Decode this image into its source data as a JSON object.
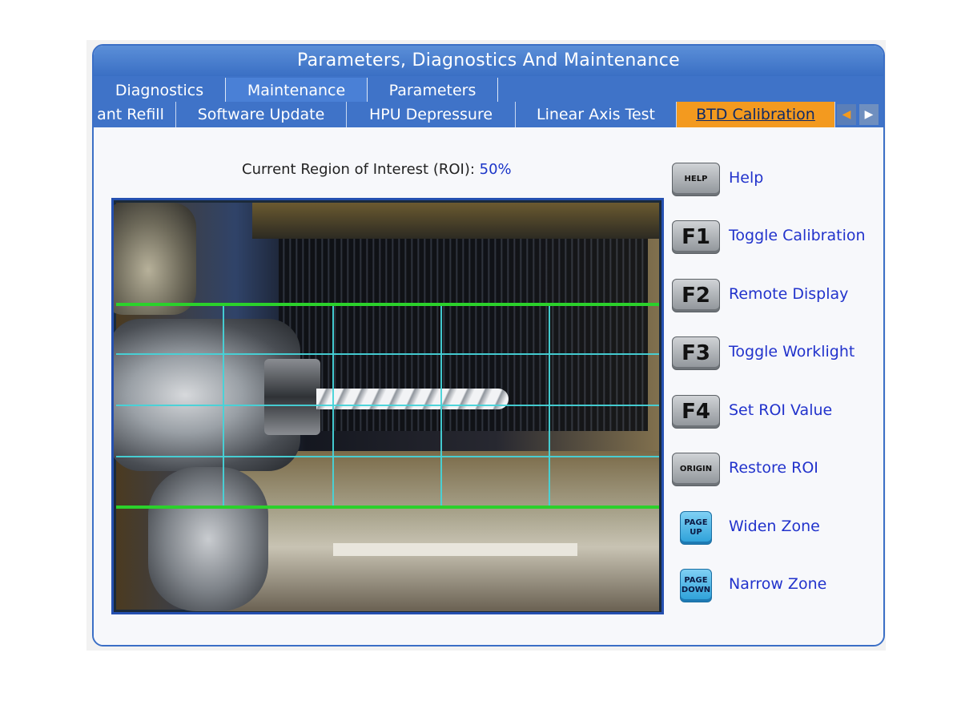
{
  "window": {
    "title": "Parameters, Diagnostics And Maintenance"
  },
  "tabs_primary": [
    {
      "label": "Diagnostics",
      "active": false
    },
    {
      "label": "Maintenance",
      "active": true
    },
    {
      "label": "Parameters",
      "active": false
    }
  ],
  "tabs_secondary": [
    {
      "label": "ant Refill",
      "active": false
    },
    {
      "label": "Software Update",
      "active": false
    },
    {
      "label": "HPU Depressure",
      "active": false
    },
    {
      "label": "Linear Axis Test",
      "active": false
    },
    {
      "label": "BTD Calibration",
      "active": true
    }
  ],
  "scroll_arrows": {
    "left": "◀",
    "right": "▶"
  },
  "roi": {
    "label": "Current Region of Interest (ROI):",
    "value": "50%"
  },
  "camera": {
    "icon": "camera-feed",
    "overlay_color": "#46d3d8",
    "zone_color": "#2bd12b"
  },
  "keys": [
    {
      "key": "HELP",
      "label": "Help",
      "style": "gray-small"
    },
    {
      "key": "F1",
      "label": "Toggle Calibration",
      "style": "gray-big"
    },
    {
      "key": "F2",
      "label": "Remote Display",
      "style": "gray-big"
    },
    {
      "key": "F3",
      "label": "Toggle Worklight",
      "style": "gray-big"
    },
    {
      "key": "F4",
      "label": "Set ROI Value",
      "style": "gray-big"
    },
    {
      "key": "ORIGIN",
      "label": "Restore ROI",
      "style": "gray-small"
    },
    {
      "key_line1": "PAGE",
      "key_line2": "UP",
      "label": "Widen Zone",
      "style": "blue"
    },
    {
      "key_line1": "PAGE",
      "key_line2": "DOWN",
      "label": "Narrow Zone",
      "style": "blue"
    }
  ],
  "colors": {
    "accent": "#3f73c8",
    "active_tab": "#f39a1f",
    "link": "#2233cc"
  }
}
